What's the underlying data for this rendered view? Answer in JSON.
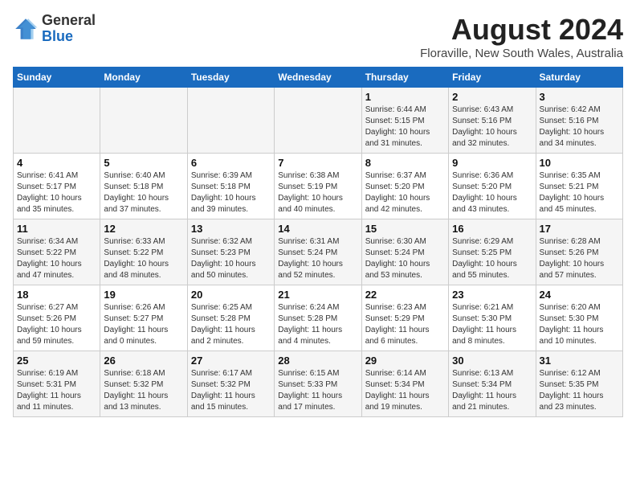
{
  "logo": {
    "general": "General",
    "blue": "Blue"
  },
  "title": "August 2024",
  "subtitle": "Floraville, New South Wales, Australia",
  "weekdays": [
    "Sunday",
    "Monday",
    "Tuesday",
    "Wednesday",
    "Thursday",
    "Friday",
    "Saturday"
  ],
  "weeks": [
    [
      {
        "day": "",
        "info": ""
      },
      {
        "day": "",
        "info": ""
      },
      {
        "day": "",
        "info": ""
      },
      {
        "day": "",
        "info": ""
      },
      {
        "day": "1",
        "info": "Sunrise: 6:44 AM\nSunset: 5:15 PM\nDaylight: 10 hours\nand 31 minutes."
      },
      {
        "day": "2",
        "info": "Sunrise: 6:43 AM\nSunset: 5:16 PM\nDaylight: 10 hours\nand 32 minutes."
      },
      {
        "day": "3",
        "info": "Sunrise: 6:42 AM\nSunset: 5:16 PM\nDaylight: 10 hours\nand 34 minutes."
      }
    ],
    [
      {
        "day": "4",
        "info": "Sunrise: 6:41 AM\nSunset: 5:17 PM\nDaylight: 10 hours\nand 35 minutes."
      },
      {
        "day": "5",
        "info": "Sunrise: 6:40 AM\nSunset: 5:18 PM\nDaylight: 10 hours\nand 37 minutes."
      },
      {
        "day": "6",
        "info": "Sunrise: 6:39 AM\nSunset: 5:18 PM\nDaylight: 10 hours\nand 39 minutes."
      },
      {
        "day": "7",
        "info": "Sunrise: 6:38 AM\nSunset: 5:19 PM\nDaylight: 10 hours\nand 40 minutes."
      },
      {
        "day": "8",
        "info": "Sunrise: 6:37 AM\nSunset: 5:20 PM\nDaylight: 10 hours\nand 42 minutes."
      },
      {
        "day": "9",
        "info": "Sunrise: 6:36 AM\nSunset: 5:20 PM\nDaylight: 10 hours\nand 43 minutes."
      },
      {
        "day": "10",
        "info": "Sunrise: 6:35 AM\nSunset: 5:21 PM\nDaylight: 10 hours\nand 45 minutes."
      }
    ],
    [
      {
        "day": "11",
        "info": "Sunrise: 6:34 AM\nSunset: 5:22 PM\nDaylight: 10 hours\nand 47 minutes."
      },
      {
        "day": "12",
        "info": "Sunrise: 6:33 AM\nSunset: 5:22 PM\nDaylight: 10 hours\nand 48 minutes."
      },
      {
        "day": "13",
        "info": "Sunrise: 6:32 AM\nSunset: 5:23 PM\nDaylight: 10 hours\nand 50 minutes."
      },
      {
        "day": "14",
        "info": "Sunrise: 6:31 AM\nSunset: 5:24 PM\nDaylight: 10 hours\nand 52 minutes."
      },
      {
        "day": "15",
        "info": "Sunrise: 6:30 AM\nSunset: 5:24 PM\nDaylight: 10 hours\nand 53 minutes."
      },
      {
        "day": "16",
        "info": "Sunrise: 6:29 AM\nSunset: 5:25 PM\nDaylight: 10 hours\nand 55 minutes."
      },
      {
        "day": "17",
        "info": "Sunrise: 6:28 AM\nSunset: 5:26 PM\nDaylight: 10 hours\nand 57 minutes."
      }
    ],
    [
      {
        "day": "18",
        "info": "Sunrise: 6:27 AM\nSunset: 5:26 PM\nDaylight: 10 hours\nand 59 minutes."
      },
      {
        "day": "19",
        "info": "Sunrise: 6:26 AM\nSunset: 5:27 PM\nDaylight: 11 hours\nand 0 minutes."
      },
      {
        "day": "20",
        "info": "Sunrise: 6:25 AM\nSunset: 5:28 PM\nDaylight: 11 hours\nand 2 minutes."
      },
      {
        "day": "21",
        "info": "Sunrise: 6:24 AM\nSunset: 5:28 PM\nDaylight: 11 hours\nand 4 minutes."
      },
      {
        "day": "22",
        "info": "Sunrise: 6:23 AM\nSunset: 5:29 PM\nDaylight: 11 hours\nand 6 minutes."
      },
      {
        "day": "23",
        "info": "Sunrise: 6:21 AM\nSunset: 5:30 PM\nDaylight: 11 hours\nand 8 minutes."
      },
      {
        "day": "24",
        "info": "Sunrise: 6:20 AM\nSunset: 5:30 PM\nDaylight: 11 hours\nand 10 minutes."
      }
    ],
    [
      {
        "day": "25",
        "info": "Sunrise: 6:19 AM\nSunset: 5:31 PM\nDaylight: 11 hours\nand 11 minutes."
      },
      {
        "day": "26",
        "info": "Sunrise: 6:18 AM\nSunset: 5:32 PM\nDaylight: 11 hours\nand 13 minutes."
      },
      {
        "day": "27",
        "info": "Sunrise: 6:17 AM\nSunset: 5:32 PM\nDaylight: 11 hours\nand 15 minutes."
      },
      {
        "day": "28",
        "info": "Sunrise: 6:15 AM\nSunset: 5:33 PM\nDaylight: 11 hours\nand 17 minutes."
      },
      {
        "day": "29",
        "info": "Sunrise: 6:14 AM\nSunset: 5:34 PM\nDaylight: 11 hours\nand 19 minutes."
      },
      {
        "day": "30",
        "info": "Sunrise: 6:13 AM\nSunset: 5:34 PM\nDaylight: 11 hours\nand 21 minutes."
      },
      {
        "day": "31",
        "info": "Sunrise: 6:12 AM\nSunset: 5:35 PM\nDaylight: 11 hours\nand 23 minutes."
      }
    ]
  ]
}
